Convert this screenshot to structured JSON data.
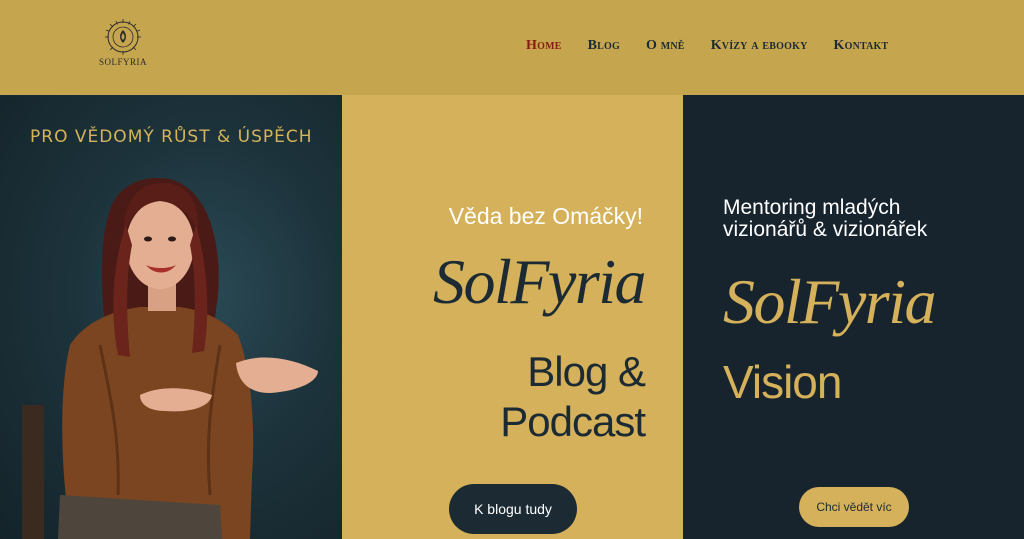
{
  "header": {
    "logo_text": "SOLFYRIA",
    "nav": [
      {
        "label": "Home",
        "active": true
      },
      {
        "label": "Blog",
        "active": false
      },
      {
        "label": "O mně",
        "active": false
      },
      {
        "label": "Kvízy a ebooky",
        "active": false
      },
      {
        "label": "Kontakt",
        "active": false
      }
    ]
  },
  "left_panel": {
    "tagline": "PRO VĚDOMÝ RŮST & ÚSPĚCH"
  },
  "mid_panel": {
    "subtitle": "Věda bez Omáčky!",
    "brand": "SolFyria",
    "title_line1": "Blog &",
    "title_line2": "Podcast",
    "button_label": "K blogu tudy"
  },
  "right_panel": {
    "subtitle_line1": "Mentoring mladých",
    "subtitle_line2": "vizionářů & vizionářek",
    "brand": "SolFyria",
    "title": "Vision",
    "button_label": "Chci vědět víc"
  },
  "colors": {
    "header_bg": "#c5a64f",
    "gold": "#d4b15a",
    "navy": "#1c2b33",
    "active_nav": "#8a1a14"
  }
}
